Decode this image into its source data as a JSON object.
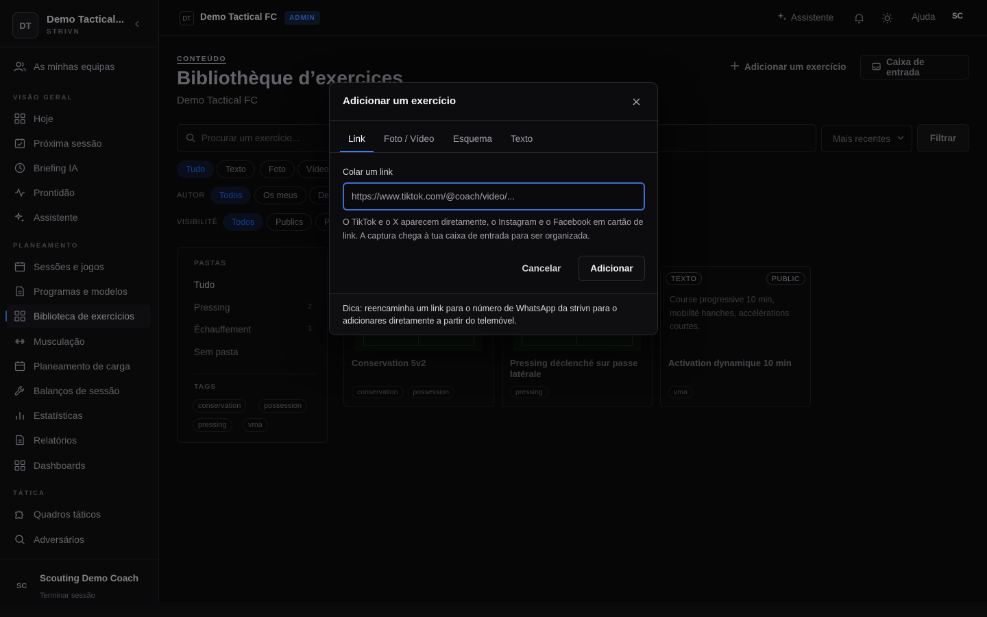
{
  "workspace": {
    "initials": "DT",
    "name": "Demo Tactical...",
    "sub": "STRIVN"
  },
  "sidebar": {
    "my_teams": "As minhas equipas",
    "sections": {
      "overview": "VISÃO GERAL",
      "planning": "PLANEAMENTO",
      "tactics": "TÁTICA"
    },
    "overview_items": [
      {
        "label": "Hoje",
        "icon": "grid-icon"
      },
      {
        "label": "Próxima sessão",
        "icon": "calendar-check-icon"
      },
      {
        "label": "Briefing IA",
        "icon": "clock-icon"
      },
      {
        "label": "Prontidão",
        "icon": "pulse-icon"
      },
      {
        "label": "Assistente",
        "icon": "sparkle-icon"
      }
    ],
    "planning_items": [
      {
        "label": "Sessões e jogos",
        "icon": "calendar-icon"
      },
      {
        "label": "Programas e modelos",
        "icon": "document-icon"
      },
      {
        "label": "Biblioteca de exercícios",
        "icon": "grid-icon",
        "active": true
      },
      {
        "label": "Musculação",
        "icon": "dumbbell-icon"
      },
      {
        "label": "Planeamento de carga",
        "icon": "calendar-icon"
      },
      {
        "label": "Balanços de sessão",
        "icon": "wrench-icon"
      },
      {
        "label": "Estatísticas",
        "icon": "bar-chart-icon"
      },
      {
        "label": "Relatórios",
        "icon": "document-icon"
      },
      {
        "label": "Dashboards",
        "icon": "grid-icon"
      }
    ],
    "tactics_items": [
      {
        "label": "Quadros táticos",
        "icon": "puzzle-icon"
      },
      {
        "label": "Adversários",
        "icon": "search-icon"
      }
    ],
    "user": {
      "initials": "SC",
      "name": "Scouting Demo Coach",
      "logout": "Terminar sessão"
    }
  },
  "topbar": {
    "ws_initials": "DT",
    "ws_name": "Demo Tactical FC",
    "badge": "ADMIN",
    "assistant": "Assistente",
    "help": "Ajuda",
    "user_initials": "SC"
  },
  "page": {
    "eyebrow": "CONTEÚDO",
    "title": "Bibliothèque d’exercices",
    "subtitle": "Demo Tactical FC",
    "add_button": "Adicionar um exercício",
    "inbox_button": "Caixa de entrada",
    "search_placeholder": "Procurar um exercício...",
    "sort": "Mais recentes",
    "filter": "Filtrar",
    "type_chips": [
      "Tudo",
      "Texto",
      "Foto",
      "Vídeo"
    ],
    "author_label": "AUTOR",
    "author_chips": [
      "Todos",
      "Os meus",
      "De"
    ],
    "visibility_label": "VISIBILITÉ",
    "visibility_chips": [
      "Todos",
      "Publics",
      "P"
    ]
  },
  "folders": {
    "head": "PASTAS",
    "items": [
      {
        "label": "Tudo",
        "count": ""
      },
      {
        "label": "Pressing",
        "count": "2"
      },
      {
        "label": "Échauffement",
        "count": "1"
      },
      {
        "label": "Sem pasta",
        "count": ""
      }
    ],
    "tags_head": "TAGS",
    "tags": [
      "conservation",
      "possession",
      "pressing",
      "vma"
    ]
  },
  "cards": [
    {
      "title": "Conservation 5v2",
      "tags": [
        "conservation",
        "possession"
      ]
    },
    {
      "title": "Pressing déclenché sur passe latérale",
      "tags": [
        "pressing"
      ]
    },
    {
      "title": "Activation dynamique 10 min",
      "tags": [
        "vma"
      ],
      "type": "TEXTO",
      "visibility": "PUBLIC",
      "desc": "Course progressive 10 min, mobilité hanches, accélérations courtes."
    }
  ],
  "modal": {
    "title": "Adicionar um exercício",
    "tabs": [
      "Link",
      "Foto / Vídeo",
      "Esquema",
      "Texto"
    ],
    "label": "Colar um link",
    "placeholder": "https://www.tiktok.com/@coach/video/...",
    "help": "O TikTok e o X aparecem diretamente, o Instagram e o Facebook em cartão de link. A captura chega à tua caixa de entrada para ser organizada.",
    "cancel": "Cancelar",
    "submit": "Adicionar",
    "tip": "Dica: reencaminha um link para o número de WhatsApp da strivn para o adicionares diretamente a partir do telemóvel."
  }
}
